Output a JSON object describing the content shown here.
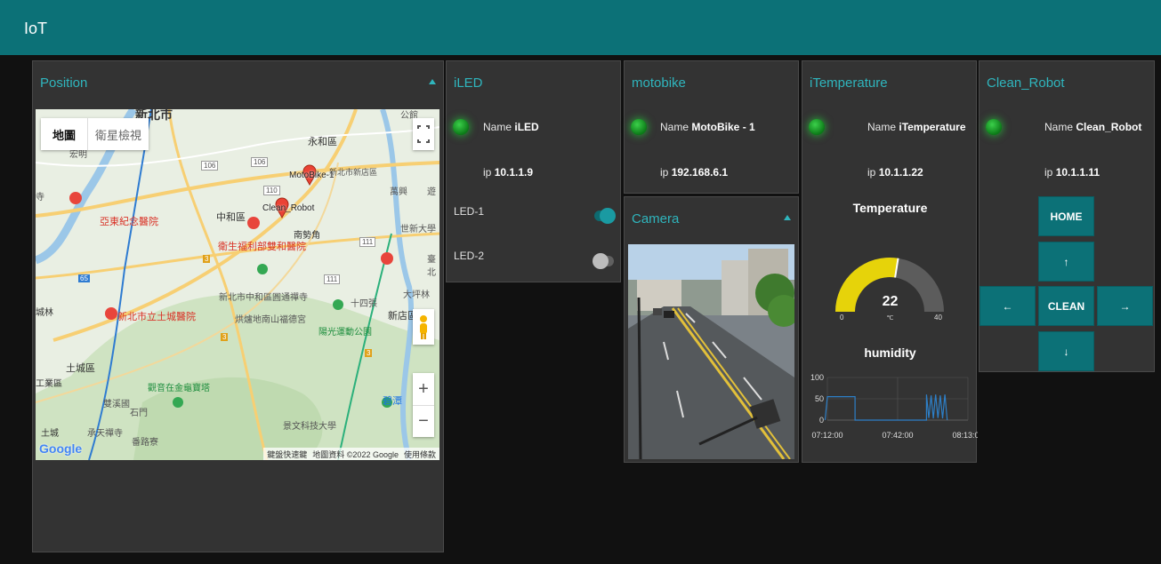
{
  "app": {
    "title": "IoT"
  },
  "position": {
    "title": "Position",
    "map": {
      "type_buttons": [
        "地圖",
        "衛星檢視"
      ],
      "markers": [
        "MotoBike-1",
        "Clean_Robot"
      ],
      "places": [
        "新北市",
        "永和區",
        "中和區",
        "南勢角",
        "亞東紀念醫院",
        "衛生福利部雙和醫院",
        "新北市立土城醫院",
        "新北市中和區圓通禪寺",
        "烘爐地南山福德宮",
        "陽光運動公園",
        "新店區",
        "世新大學",
        "景文科技大學",
        "土城區",
        "觀音在金龜寶塔",
        "雙溪國",
        "石門",
        "承天禪寺",
        "番路寮",
        "十四張",
        "碧潭",
        "萬興",
        "大坪林",
        "臺北",
        "宏明",
        "土城",
        "工業區",
        "城林",
        "公館",
        "新北市新店區",
        "寺",
        "遊"
      ],
      "road_labels": [
        "106",
        "106",
        "111",
        "111",
        "65",
        "3",
        "3",
        "3",
        "110"
      ],
      "logo": "Google",
      "attribution": [
        "鍵盤快速鍵",
        "地圖資料 ©2022 Google",
        "使用條款"
      ],
      "zoom_in": "+",
      "zoom_out": "−"
    }
  },
  "iled": {
    "title": "iLED",
    "name_label": "Name",
    "name": "iLED",
    "ip_label": "ip",
    "ip": "10.1.1.9",
    "switches": [
      {
        "label": "LED-1",
        "on": true
      },
      {
        "label": "LED-2",
        "on": false
      }
    ]
  },
  "motobike": {
    "title": "motobike",
    "name_label": "Name",
    "name": "MotoBike - 1",
    "ip_label": "ip",
    "ip": "192.168.6.1"
  },
  "camera": {
    "title": "Camera"
  },
  "itemperature": {
    "title": "iTemperature",
    "name_label": "Name",
    "name": "iTemperature",
    "ip_label": "ip",
    "ip": "10.1.1.22",
    "gauge": {
      "title": "Temperature",
      "value": "22",
      "unit": "℃",
      "min": "0",
      "max": "40"
    },
    "humidity_chart_title": "humidity"
  },
  "clean_robot": {
    "title": "Clean_Robot",
    "name_label": "Name",
    "name": "Clean_Robot",
    "ip_label": "ip",
    "ip": "10.1.1.11",
    "buttons": {
      "home": "HOME",
      "up": "↑",
      "left": "←",
      "clean": "CLEAN",
      "right": "→",
      "down": "↓"
    }
  },
  "colors": {
    "header": "#0c7177",
    "accent": "#2fb5bd",
    "panel": "#333333",
    "background": "#111111",
    "gauge_fill": "#e6d30a",
    "gauge_track": "#5c5c5c",
    "line": "#2d7fc7"
  },
  "chart_data": {
    "type": "line",
    "title": "humidity",
    "x_ticks": [
      "07:12:00",
      "07:42:00",
      "08:13:00"
    ],
    "y_ticks": [
      "100",
      "50",
      "0"
    ],
    "ylim": [
      0,
      100
    ],
    "grid": true,
    "series": [
      {
        "x": [
          "07:11",
          "07:12",
          "07:12",
          "07:24",
          "07:24",
          "07:55",
          "07:55",
          "07:56",
          "07:57",
          "07:58",
          "07:59",
          "08:00",
          "08:01",
          "08:02",
          "08:03",
          "08:04"
        ],
        "values": [
          0,
          55,
          55,
          55,
          0,
          0,
          60,
          5,
          58,
          4,
          60,
          5,
          58,
          4,
          60,
          0
        ]
      }
    ]
  }
}
